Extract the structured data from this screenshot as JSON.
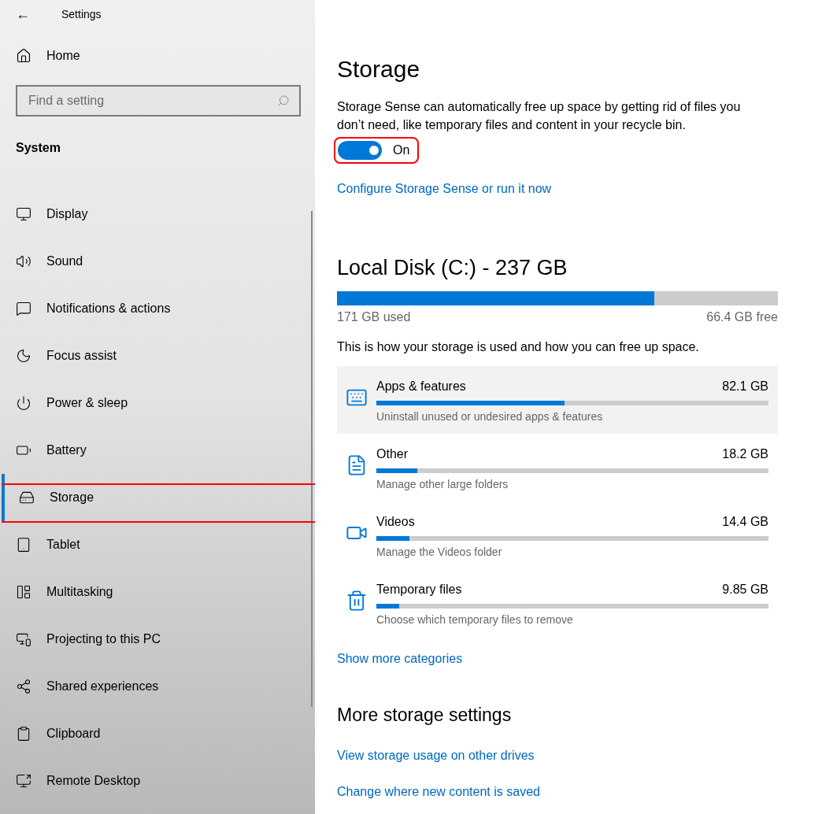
{
  "window": {
    "title": "Settings",
    "back": "←"
  },
  "sidebar": {
    "home": "Home",
    "search": {
      "placeholder": "Find a setting"
    },
    "section": "System",
    "items": [
      {
        "label": "Display",
        "selected": false
      },
      {
        "label": "Sound",
        "selected": false
      },
      {
        "label": "Notifications & actions",
        "selected": false
      },
      {
        "label": "Focus assist",
        "selected": false
      },
      {
        "label": "Power & sleep",
        "selected": false
      },
      {
        "label": "Battery",
        "selected": false
      },
      {
        "label": "Storage",
        "selected": true
      },
      {
        "label": "Tablet",
        "selected": false
      },
      {
        "label": "Multitasking",
        "selected": false
      },
      {
        "label": "Projecting to this PC",
        "selected": false
      },
      {
        "label": "Shared experiences",
        "selected": false
      },
      {
        "label": "Clipboard",
        "selected": false
      },
      {
        "label": "Remote Desktop",
        "selected": false
      }
    ]
  },
  "main": {
    "title": "Storage",
    "description": "Storage Sense can automatically free up space by getting rid of files you don’t need, like temporary files and content in your recycle bin.",
    "storage_sense": {
      "on": true,
      "label": "On"
    },
    "configure_link": "Configure Storage Sense or run it now",
    "disk": {
      "title": "Local Disk (C:) - 237 GB",
      "level": 0.72,
      "used": "171 GB used",
      "free": "66.4 GB free"
    },
    "usage_intro": "This is how your storage is used and how you can free up space.",
    "categories": [
      {
        "name": "Apps & features",
        "size": "82.1 GB",
        "level": 0.48,
        "hint": "Uninstall unused or undesired apps & features",
        "selected": true
      },
      {
        "name": "Other",
        "size": "18.2 GB",
        "level": 0.105,
        "hint": "Manage other large folders",
        "selected": false
      },
      {
        "name": "Videos",
        "size": "14.4 GB",
        "level": 0.085,
        "hint": "Manage the Videos folder",
        "selected": false
      },
      {
        "name": "Temporary files",
        "size": "9.85 GB",
        "level": 0.058,
        "hint": "Choose which temporary files to remove",
        "selected": false
      }
    ],
    "more_link": "Show more categories",
    "more_title": "More storage settings",
    "links": [
      "View storage usage on other drives",
      "Change where new content is saved"
    ]
  }
}
